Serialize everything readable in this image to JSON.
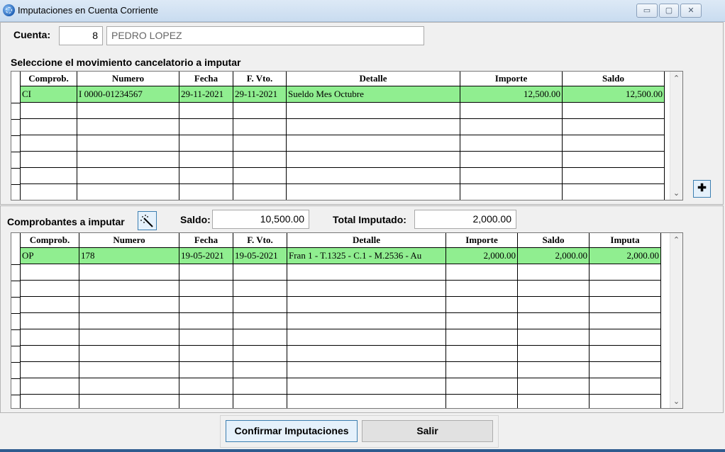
{
  "window": {
    "title": "Imputaciones en Cuenta Corriente"
  },
  "account": {
    "label": "Cuenta:",
    "number": "8",
    "name": "PEDRO LOPEZ"
  },
  "top_section": {
    "heading": "Seleccione el movimiento cancelatorio a imputar",
    "columns": [
      "Comprob.",
      "Numero",
      "Fecha",
      "F. Vto.",
      "Detalle",
      "Importe",
      "Saldo"
    ],
    "rows": [
      [
        "CI",
        "I 0000-01234567",
        "29-11-2021",
        "29-11-2021",
        "Sueldo Mes Octubre",
        "12,500.00",
        "12,500.00"
      ]
    ]
  },
  "bottom_section": {
    "heading": "Comprobantes a imputar",
    "saldo_label": "Saldo:",
    "saldo_value": "10,500.00",
    "total_label": "Total Imputado:",
    "total_value": "2,000.00",
    "columns": [
      "Comprob.",
      "Numero",
      "Fecha",
      "F. Vto.",
      "Detalle",
      "Importe",
      "Saldo",
      "Imputa"
    ],
    "rows": [
      [
        "OP",
        "178",
        "19-05-2021",
        "19-05-2021",
        "Fran 1 - T.1325 - C.1 - M.2536 - Au",
        "2,000.00",
        "2,000.00",
        "2,000.00"
      ]
    ]
  },
  "buttons": {
    "confirm": "Confirmar Imputaciones",
    "exit": "Salir"
  },
  "colors": {
    "selected_row": "#90ee90",
    "titlebar": "#dde9f6"
  },
  "icons": {
    "app": "app-globe-icon",
    "add": "plus-icon",
    "wand": "magic-wand-icon"
  }
}
